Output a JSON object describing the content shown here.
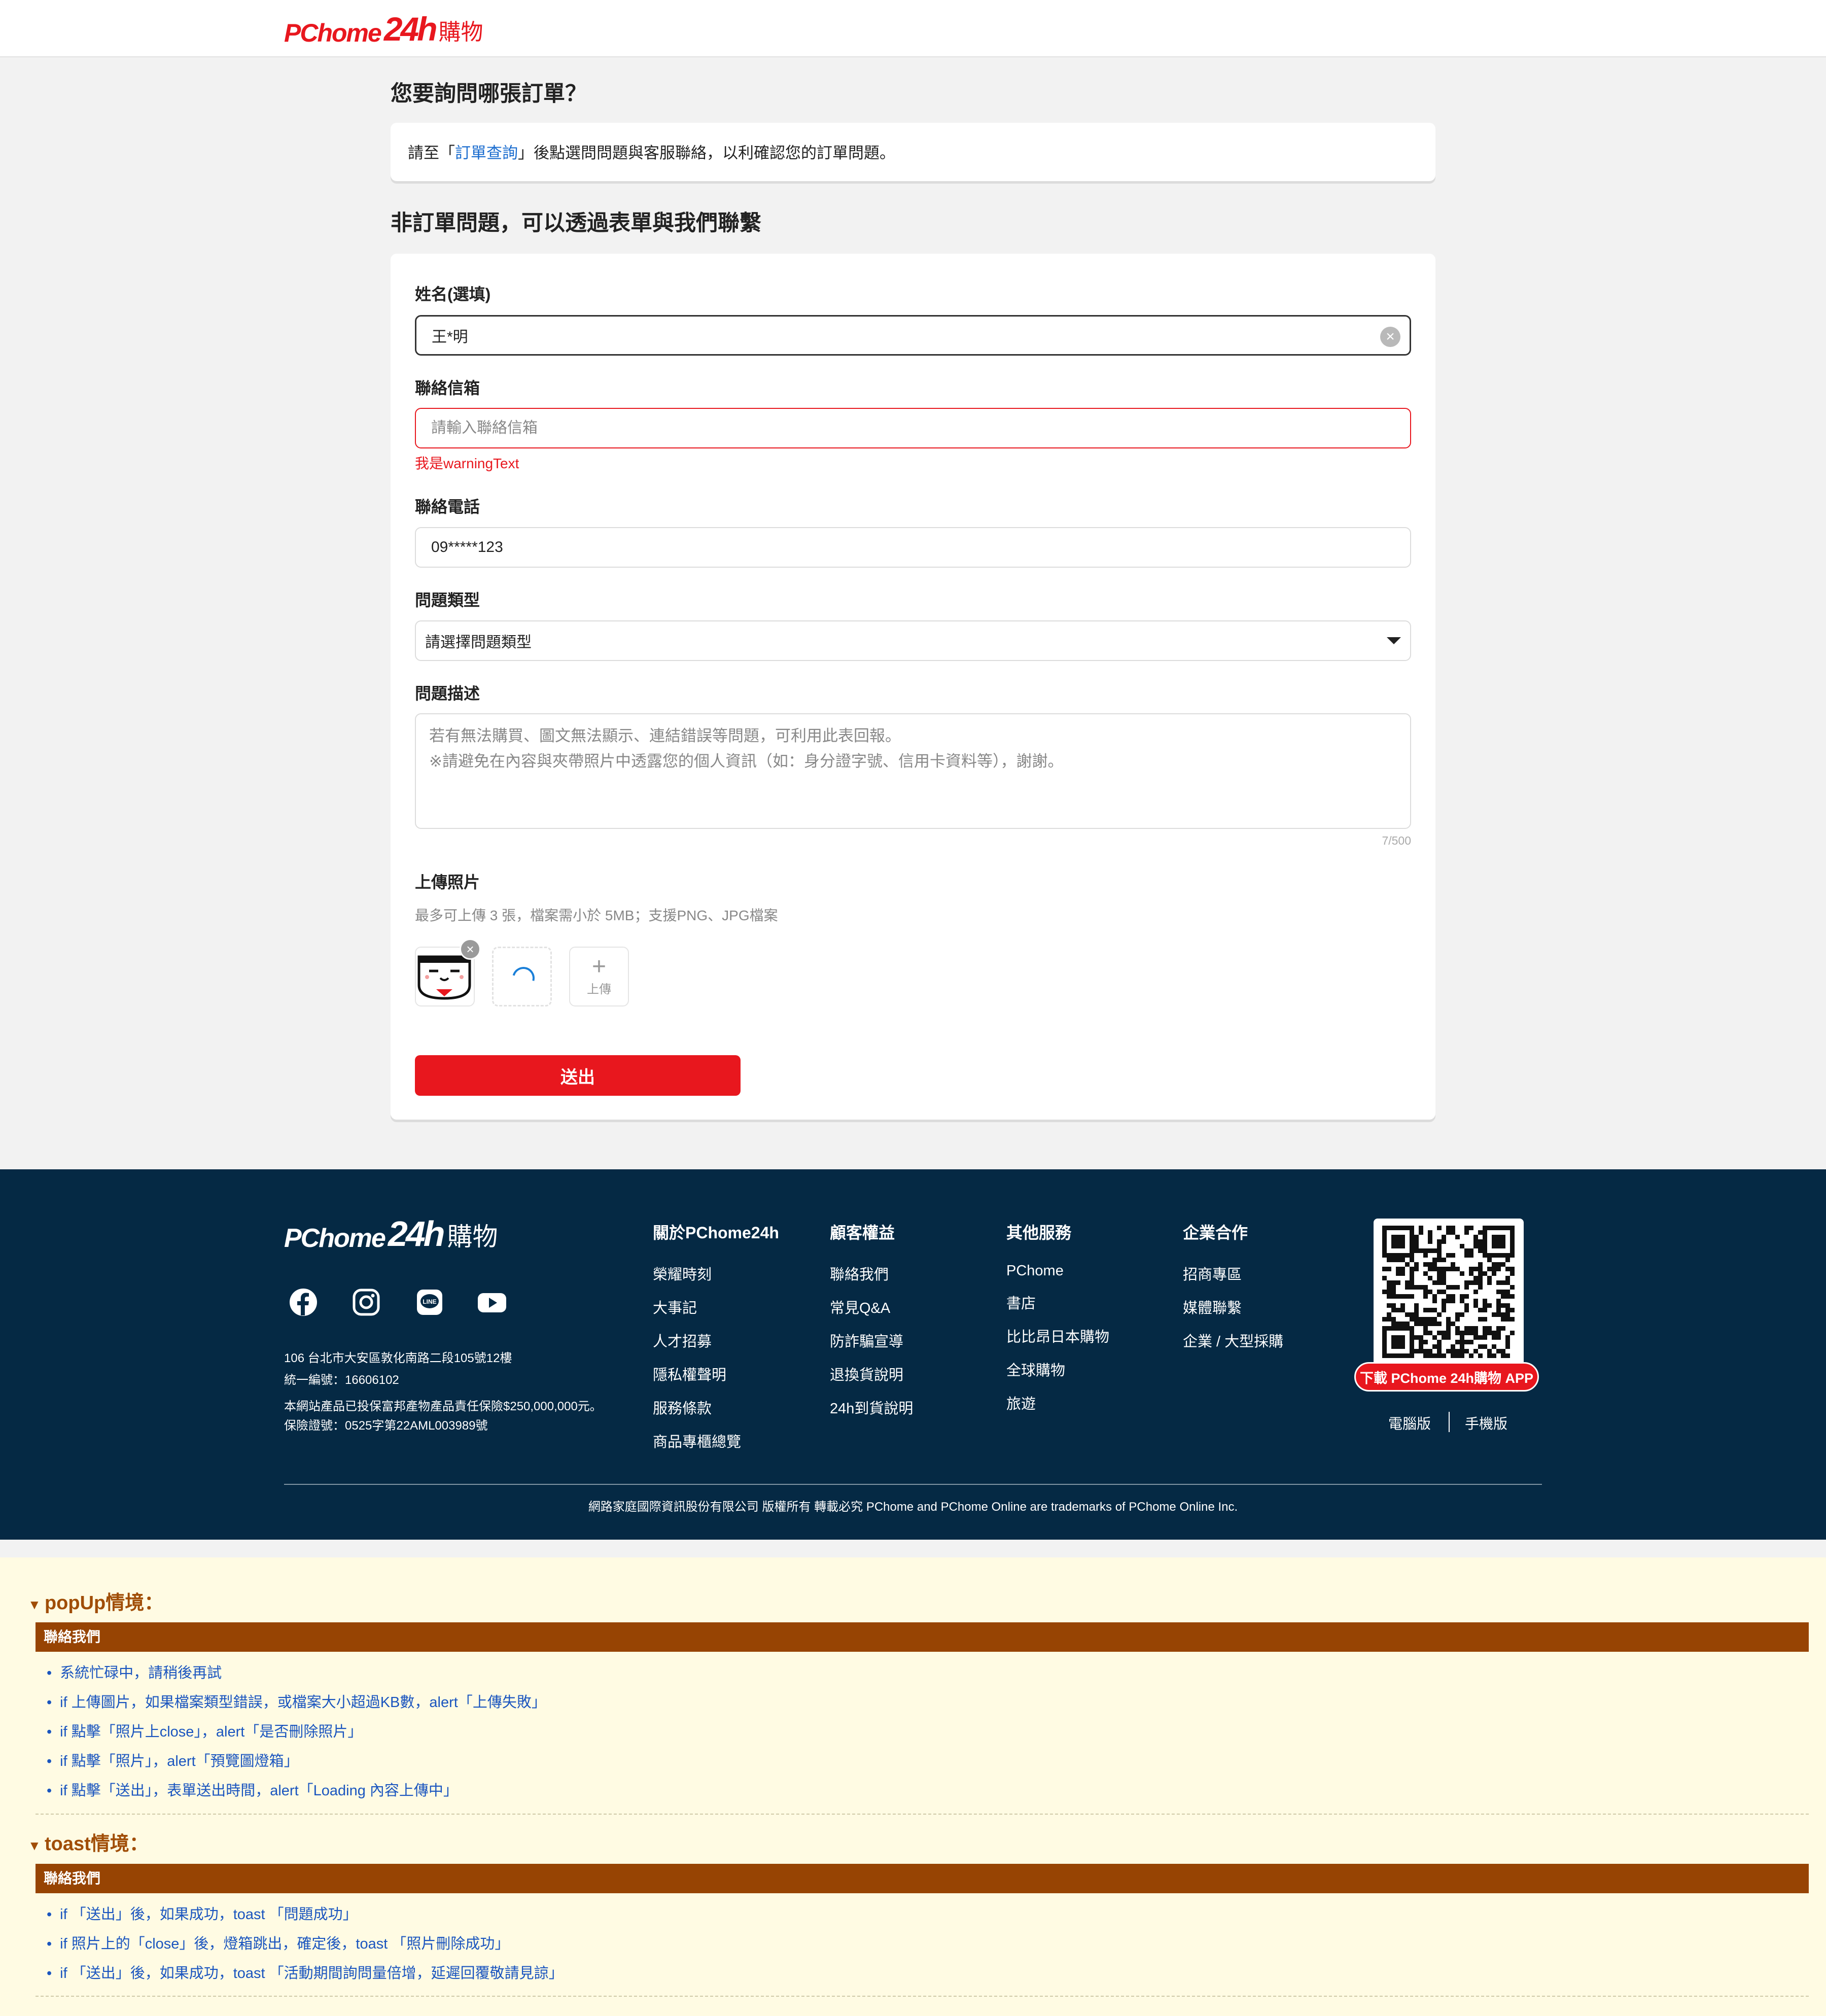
{
  "header": {
    "logo_pc": "PChome",
    "logo_24h": "24h",
    "logo_shop": "購物"
  },
  "order_section": {
    "title": "您要詢問哪張訂單？",
    "notice_before": "請至「",
    "notice_link": "訂單查詢",
    "notice_after": "」後點選問問題與客服聯絡，以利確認您的訂單問題。"
  },
  "form_section": {
    "title": "非訂單問題，可以透過表單與我們聯繫",
    "name_label": "姓名(選填)",
    "name_value": "王*明",
    "email_label": "聯絡信箱",
    "email_placeholder": "請輸入聯絡信箱",
    "email_warning": "我是warningText",
    "phone_label": "聯絡電話",
    "phone_value": "09*****123",
    "type_label": "問題類型",
    "type_selected": "請選擇問題類型",
    "desc_label": "問題描述",
    "desc_placeholder_line1": "若有無法購買、圖文無法顯示、連結錯誤等問題，可利用此表回報。",
    "desc_placeholder_line2": "※請避免在內容與夾帶照片中透露您的個人資訊（如：身分證字號、信用卡資料等），謝謝。",
    "desc_count": "7/500",
    "upload_label": "上傳照片",
    "upload_hint": "最多可上傳 3 張，檔案需小於 5MB；支援PNG、JPG檔案",
    "upload_button_label": "上傳",
    "submit_label": "送出"
  },
  "footer": {
    "logo_pc": "PChome",
    "logo_24h": "24h",
    "logo_shop": "購物",
    "address": "106 台北市大安區敦化南路二段105號12樓",
    "tax_id": "統一編號：16606102",
    "insurance_line1": "本網站產品已投保富邦產物產品責任保險$250,000,000元。",
    "insurance_line2": "保險證號：0525字第22AML003989號",
    "columns": [
      {
        "title": "關於PChome24h",
        "items": [
          "榮耀時刻",
          "大事記",
          "人才招募",
          "隱私權聲明",
          "服務條款",
          "商品專櫃總覽"
        ]
      },
      {
        "title": "顧客權益",
        "items": [
          "聯絡我們",
          "常見Q&A",
          "防詐騙宣導",
          "退換貨說明",
          "24h到貨說明"
        ]
      },
      {
        "title": "其他服務",
        "items": [
          "PChome",
          "書店",
          "比比昂日本購物",
          "全球購物",
          "旅遊"
        ]
      },
      {
        "title": "企業合作",
        "items": [
          "招商專區",
          "媒體聯繫",
          "企業 / 大型採購"
        ]
      }
    ],
    "app_download": "下載 PChome 24h購物 APP",
    "desktop_version": "電腦版",
    "mobile_version": "手機版",
    "copyright": "網路家庭國際資訊股份有限公司 版權所有 轉載必究   PChome and PChome Online are trademarks of PChome Online Inc."
  },
  "notes": {
    "popup_title": "popUp情境：",
    "popup_bar": "聯絡我們",
    "popup_items": [
      "系統忙碌中，請稍後再試",
      "if 上傳圖片，如果檔案類型錯誤，或檔案大小超過KB數，alert「上傳失敗」",
      "if 點擊「照片上close」，alert「是否刪除照片」",
      "if 點擊「照片」，alert「預覽圖燈箱」",
      "if 點擊「送出」，表單送出時間，alert「Loading 內容上傳中」"
    ],
    "toast_title": "toast情境：",
    "toast_bar": "聯絡我們",
    "toast_items": [
      "if 「送出」後，如果成功，toast 「問題成功」",
      "if 照片上的「close」後，燈箱跳出，確定後，toast 「照片刪除成功」",
      "if 「送出」後，如果成功，toast 「活動期間詢問量倍增，延遲回覆敬請見諒」"
    ]
  }
}
